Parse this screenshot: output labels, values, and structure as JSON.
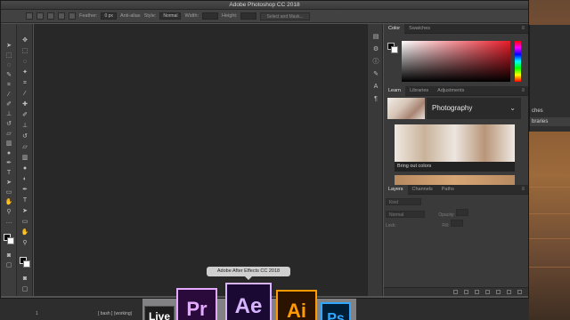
{
  "window": {
    "title": "Adobe Photoshop CC 2018"
  },
  "options_bar": {
    "feather_label": "Feather:",
    "feather_value": "0 px",
    "antialias_label": "Anti-alias",
    "style_label": "Style:",
    "style_value": "Normal",
    "width_label": "Width:",
    "height_label": "Height:",
    "select_mask_label": "Select and Mask..."
  },
  "color_panel": {
    "tabs": [
      "Color",
      "Swatches"
    ],
    "active_tab": "Color",
    "foreground": "#000000",
    "background": "#ffffff",
    "hue_accent": "#e81c29"
  },
  "learn_panel": {
    "tabs": [
      "Learn",
      "Libraries",
      "Adjustments"
    ],
    "active_tab": "Learn",
    "header": "Photography",
    "card_caption": "Bring out colors"
  },
  "layers_panel": {
    "tabs": [
      "Layers",
      "Channels",
      "Paths"
    ],
    "active_tab": "Layers",
    "kind_label": "Kind",
    "mode_value": "Normal",
    "opacity_label": "Opacity:",
    "lock_label": "Lock:",
    "fill_label": "Fill:"
  },
  "background_window": {
    "items": [
      "ches",
      "braries"
    ]
  },
  "status": {
    "zoom_text": "1",
    "info_text": "[ bash ] (working)"
  },
  "dock": {
    "tooltip": "Adobe After Effects CC 2018",
    "apps": [
      {
        "label": "Live",
        "color": "#1e1e1e",
        "fg": "#ffffff"
      },
      {
        "label": "Pr",
        "color": "#2a0a3a",
        "fg": "#e3a9ff"
      },
      {
        "label": "Ae",
        "color": "#1a0a33",
        "fg": "#d8b4ff"
      },
      {
        "label": "Ai",
        "color": "#2c1300",
        "fg": "#ff9a00"
      },
      {
        "label": "Ps",
        "color": "#001e36",
        "fg": "#31a8ff"
      }
    ]
  }
}
